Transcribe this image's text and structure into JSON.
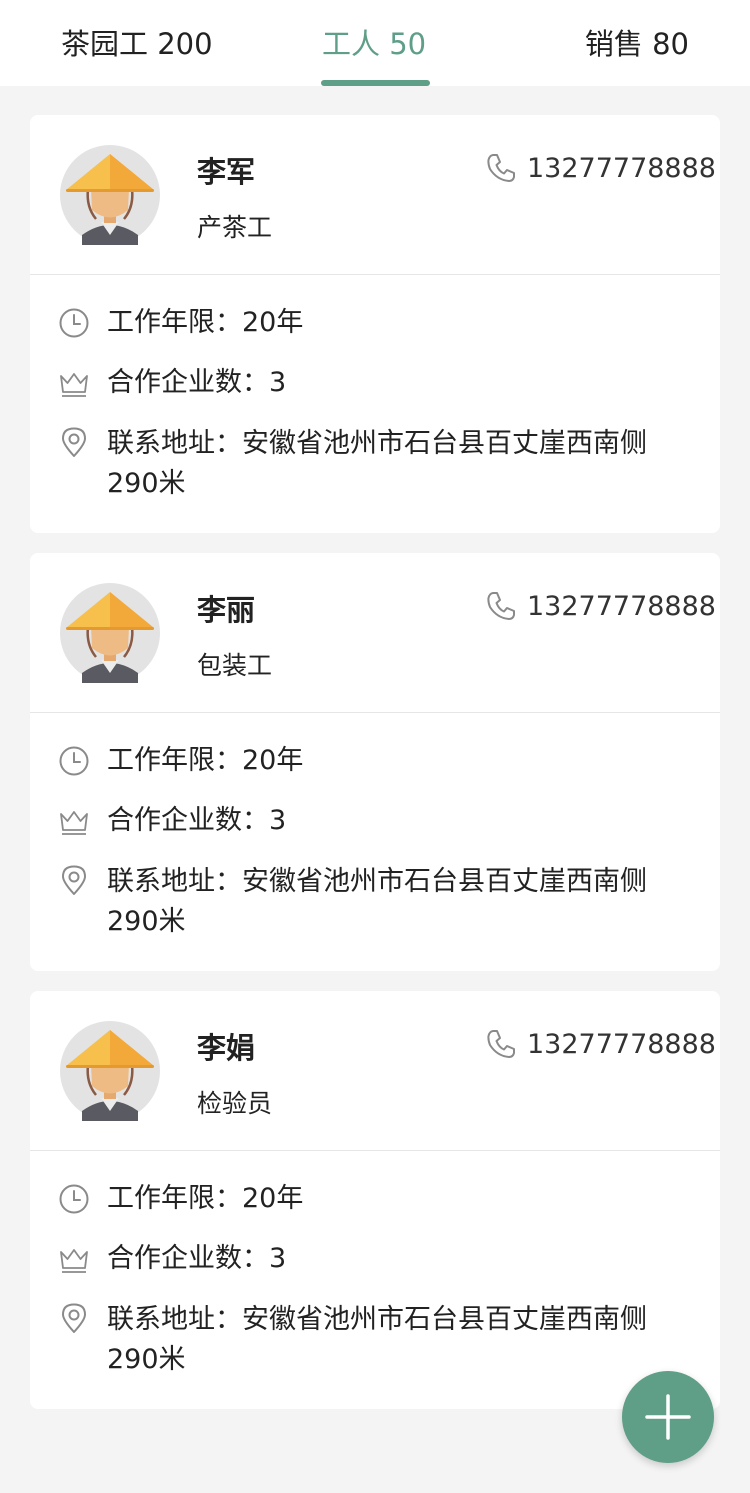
{
  "tabs": [
    {
      "label": "茶园工 200",
      "active": false
    },
    {
      "label": "工人 50",
      "active": true
    },
    {
      "label": "销售 80",
      "active": false
    }
  ],
  "colors": {
    "accent": "#5f9e87",
    "background": "#f4f4f4",
    "card": "#ffffff"
  },
  "icons": {
    "phone": "phone-icon",
    "years": "clock-icon",
    "companies": "crown-icon",
    "address": "location-pin-icon",
    "add": "plus-icon",
    "avatar": "farmer-avatar-icon"
  },
  "workers": [
    {
      "name": "李军",
      "role": "产茶工",
      "phone": "13277778888",
      "years": "工作年限：20年",
      "companies": "合作企业数：3",
      "address": "联系地址：安徽省池州市石台县百丈崖西南侧290米"
    },
    {
      "name": "李丽",
      "role": "包装工",
      "phone": "13277778888",
      "years": "工作年限：20年",
      "companies": "合作企业数：3",
      "address": "联系地址：安徽省池州市石台县百丈崖西南侧290米"
    },
    {
      "name": "李娟",
      "role": "检验员",
      "phone": "13277778888",
      "years": "工作年限：20年",
      "companies": "合作企业数：3",
      "address": "联系地址：安徽省池州市石台县百丈崖西南侧290米"
    }
  ]
}
